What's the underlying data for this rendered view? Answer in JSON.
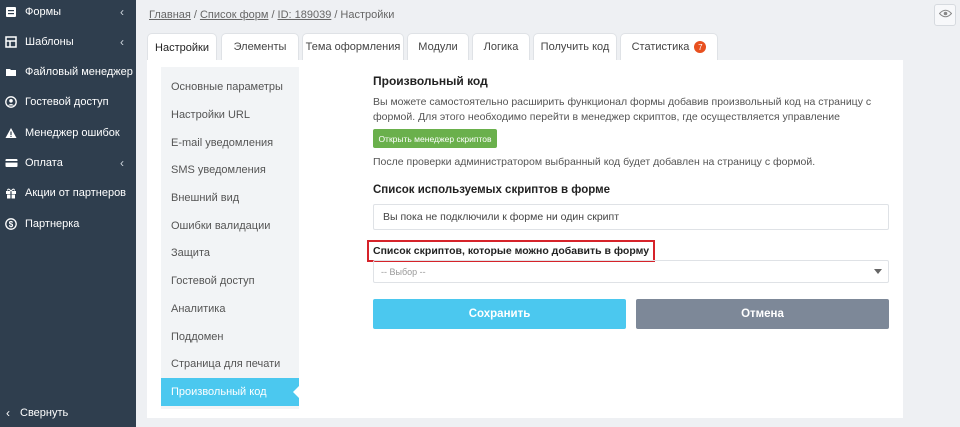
{
  "sidebar": {
    "items": [
      {
        "label": "Формы",
        "icon": "form-icon",
        "has_chevron": true
      },
      {
        "label": "Шаблоны",
        "icon": "templates-icon",
        "has_chevron": true
      },
      {
        "label": "Файловый менеджер",
        "icon": "folder-icon",
        "has_chevron": false
      },
      {
        "label": "Гостевой доступ",
        "icon": "user-circle-icon",
        "has_chevron": false
      },
      {
        "label": "Менеджер ошибок",
        "icon": "warning-icon",
        "has_chevron": false
      },
      {
        "label": "Оплата",
        "icon": "credit-card-icon",
        "has_chevron": true
      },
      {
        "label": "Акции от партнеров",
        "icon": "gift-icon",
        "has_chevron": false
      },
      {
        "label": "Партнерка",
        "icon": "dollar-icon",
        "has_chevron": false
      }
    ],
    "collapse_label": "Свернуть"
  },
  "breadcrumb": {
    "home": "Главная",
    "forms": "Список форм",
    "id": "ID: 189039",
    "current": "Настройки",
    "sep": "/"
  },
  "tabs": [
    {
      "label": "Настройки",
      "active": true
    },
    {
      "label": "Элементы"
    },
    {
      "label": "Тема оформления"
    },
    {
      "label": "Модули"
    },
    {
      "label": "Логика"
    },
    {
      "label": "Получить код"
    },
    {
      "label": "Статистика",
      "badge": "7"
    }
  ],
  "subnav": [
    "Основные параметры",
    "Настройки URL",
    "E-mail уведомления",
    "SMS уведомления",
    "Внешний вид",
    "Ошибки валидации",
    "Защита",
    "Гостевой доступ",
    "Аналитика",
    "Поддомен",
    "Страница для печати",
    "Произвольный код"
  ],
  "content": {
    "title": "Произвольный код",
    "description": "Вы можете самостоятельно расширить функционал формы добавив произвольный код на страницу с формой. Для этого необходимо перейти в менеджер скриптов, где осуществляется управление вашими скриптами.",
    "open_manager_button": "Открыть менеджер скриптов",
    "after_check_text": "После проверки администратором выбранный код будет добавлен на страницу с формой.",
    "used_scripts_heading": "Список используемых скриптов в форме",
    "no_scripts_text": "Вы пока не подключили к форме ни один скрипт",
    "available_scripts_heading": "Список скриптов, которые можно добавить в форму",
    "select_placeholder": "-- Выбор --",
    "save_button": "Сохранить",
    "cancel_button": "Отмена"
  },
  "colors": {
    "sidebar_bg": "#2f3e4e",
    "accent": "#4bc8ef",
    "green": "#6ab04c",
    "cancel": "#7d8898",
    "highlight_border": "#d6232a",
    "badge": "#e8501f"
  }
}
